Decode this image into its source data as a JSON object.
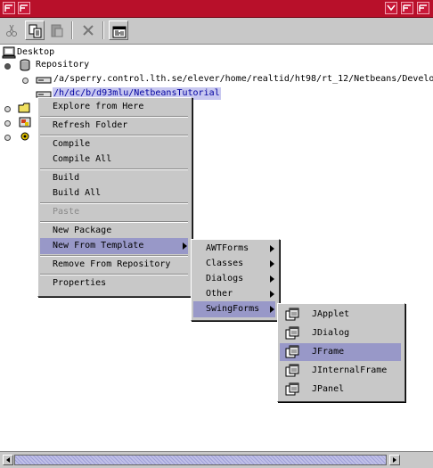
{
  "tree": {
    "root": "Desktop",
    "repository": "Repository",
    "mount_1": "/a/sperry.control.lth.se/elever/home/realtid/ht98/rt_12/Netbeans/Develo",
    "mount_2": "/h/dc/b/d93mlu/NetbeansTutorial"
  },
  "context_menu": {
    "items": [
      {
        "label": "Explore from Here"
      },
      {
        "label": "Refresh Folder"
      },
      {
        "label": "Compile"
      },
      {
        "label": "Compile All"
      },
      {
        "label": "Build"
      },
      {
        "label": "Build All"
      },
      {
        "label": "Paste",
        "disabled": true
      },
      {
        "label": "New Package"
      },
      {
        "label": "New From Template",
        "highlighted": true
      },
      {
        "label": "Remove From Repository"
      },
      {
        "label": "Properties"
      }
    ]
  },
  "template_menu": {
    "items": [
      {
        "label": "AWTForms"
      },
      {
        "label": "Classes"
      },
      {
        "label": "Dialogs"
      },
      {
        "label": "Other"
      },
      {
        "label": "SwingForms",
        "highlighted": true
      }
    ]
  },
  "swing_menu": {
    "items": [
      {
        "label": "JApplet"
      },
      {
        "label": "JDialog"
      },
      {
        "label": "JFrame",
        "highlighted": true
      },
      {
        "label": "JInternalFrame"
      },
      {
        "label": "JPanel"
      }
    ]
  },
  "colors": {
    "titlebar": "#b8102a",
    "highlight": "#9898c8",
    "selection": "#c8c8f0"
  }
}
